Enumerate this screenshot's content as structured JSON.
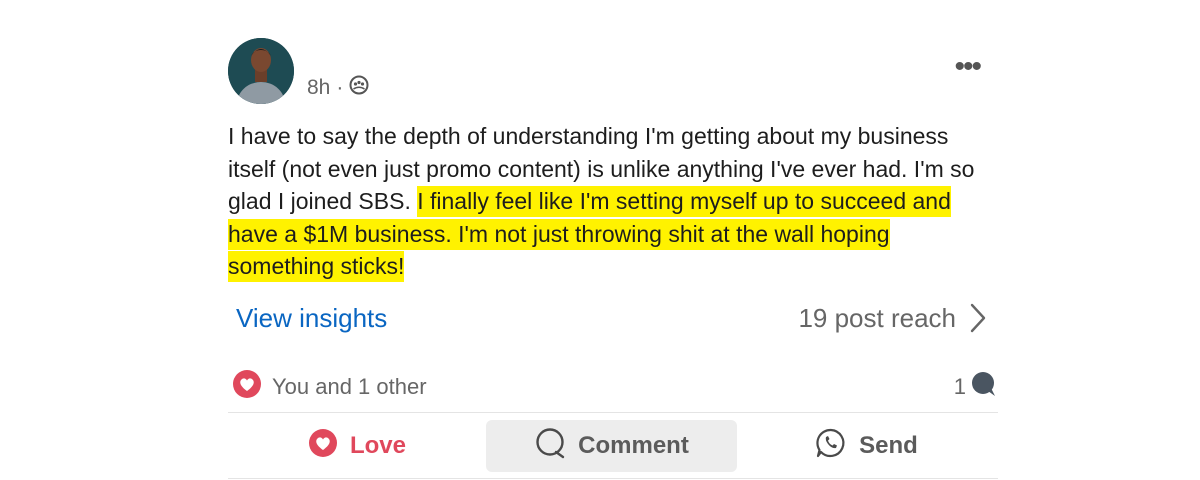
{
  "post": {
    "time": "8h",
    "separator": "·",
    "visibility_icon": "group-icon",
    "more_label": "•••",
    "text_plain": "I have to say the depth of understanding I'm getting about my business itself (not even just promo content) is unlike anything I've ever had. I'm so glad I joined SBS. ",
    "text_highlighted": "I finally feel like I'm setting myself up to succeed and have a $1M business. I'm not just throwing shit at the wall hoping something sticks!",
    "highlight_color": "#fff200"
  },
  "insights": {
    "link_label": "View insights",
    "reach_label": "19 post reach",
    "link_color": "#0a66c2"
  },
  "social": {
    "reaction_icon": "heart-icon",
    "reaction_text": "You and 1 other",
    "comment_count": "1",
    "comment_icon": "comment-bubble-icon"
  },
  "actions": {
    "love_label": "Love",
    "comment_label": "Comment",
    "send_label": "Send",
    "love_color": "#e0485c"
  }
}
